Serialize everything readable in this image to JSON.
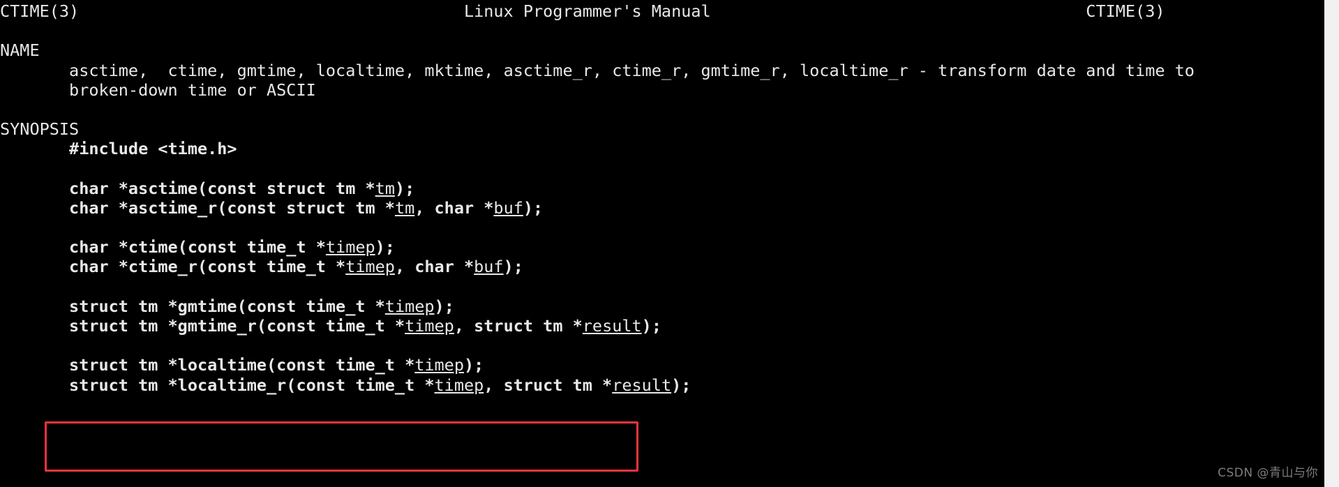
{
  "window": {
    "background_color": "#000000",
    "foreground_color": "#e8e8e8",
    "highlight_color": "#f5333f",
    "gutter_color": "#f1f1f1"
  },
  "header": {
    "left": "CTIME(3)",
    "center": "Linux Programmer's Manual",
    "right": "CTIME(3)",
    "full_line": "CTIME(3)                                       Linux Programmer's Manual                                      CTIME(3)"
  },
  "sections": [
    {
      "title": "NAME",
      "lines": [
        "       asctime,  ctime, gmtime, localtime, mktime, asctime_r, ctime_r, gmtime_r, localtime_r - transform date and time to",
        "       broken-down time or ASCII"
      ]
    },
    {
      "title": "SYNOPSIS",
      "include": "       #include <time.h>",
      "groups": [
        {
          "name": "asctime",
          "lines": [
            "       char *asctime(const struct tm *tm);",
            "       char *asctime_r(const struct tm *tm, char *buf);"
          ]
        },
        {
          "name": "ctime",
          "lines": [
            "       char *ctime(const time_t *timep);",
            "       char *ctime_r(const time_t *timep, char *buf);"
          ]
        },
        {
          "name": "gmtime",
          "lines": [
            "       struct tm *gmtime(const time_t *timep);",
            "       struct tm *gmtime_r(const time_t *timep, struct tm *result);"
          ]
        },
        {
          "name": "localtime",
          "highlighted": true,
          "lines": [
            "       struct tm *localtime(const time_t *timep);",
            "       struct tm *localtime_r(const time_t *timep, struct tm *result);"
          ]
        }
      ]
    }
  ],
  "tokens": {
    "name_section": "NAME",
    "synopsis_section": "SYNOPSIS",
    "include_directive": "#include <time.h>",
    "indent": "       ",
    "params": [
      "tm",
      "buf",
      "timep",
      "result"
    ]
  },
  "lines": {
    "header": "CTIME(3)                                       Linux Programmer's Manual                                      CTIME(3)",
    "name_title": "NAME",
    "name_body_1_pre": "       ",
    "name_body_1": "asctime,  ctime, gmtime, localtime, mktime, asctime_r, ctime_r, gmtime_r, localtime_r - transform date and time to",
    "name_body_2_pre": "       ",
    "name_body_2": "broken-down time or ASCII",
    "synopsis_title": "SYNOPSIS",
    "include_pre": "       ",
    "include": "#include <time.h>",
    "asctime_pre": "       ",
    "asctime_a": "char *asctime(const struct tm *",
    "asctime_a_param": "tm",
    "asctime_a_end": ");",
    "asctime_r_a": "char *asctime_r(const struct tm *",
    "asctime_r_p1": "tm",
    "asctime_r_mid": ", char *",
    "asctime_r_p2": "buf",
    "asctime_r_end": ");",
    "ctime_a": "char *ctime(const time_t *",
    "ctime_p1": "timep",
    "ctime_end": ");",
    "ctime_r_a": "char *ctime_r(const time_t *",
    "ctime_r_p1": "timep",
    "ctime_r_mid": ", char *",
    "ctime_r_p2": "buf",
    "ctime_r_end": ");",
    "gmtime_a": "struct tm *gmtime(const time_t *",
    "gmtime_p1": "timep",
    "gmtime_end": ");",
    "gmtime_r_a": "struct tm *gmtime_r(const time_t *",
    "gmtime_r_p1": "timep",
    "gmtime_r_mid": ", struct tm *",
    "gmtime_r_p2": "result",
    "gmtime_r_end": ");",
    "localtime_a": "struct tm *localtime(const time_t *",
    "localtime_p1": "timep",
    "localtime_end": ");",
    "localtime_r_a": "struct tm *localtime_r(const time_t *",
    "localtime_r_p1": "timep",
    "localtime_r_mid": ", struct tm *",
    "localtime_r_p2": "result",
    "localtime_r_end": ");"
  },
  "watermark": {
    "text": "CSDN @青山与你"
  }
}
